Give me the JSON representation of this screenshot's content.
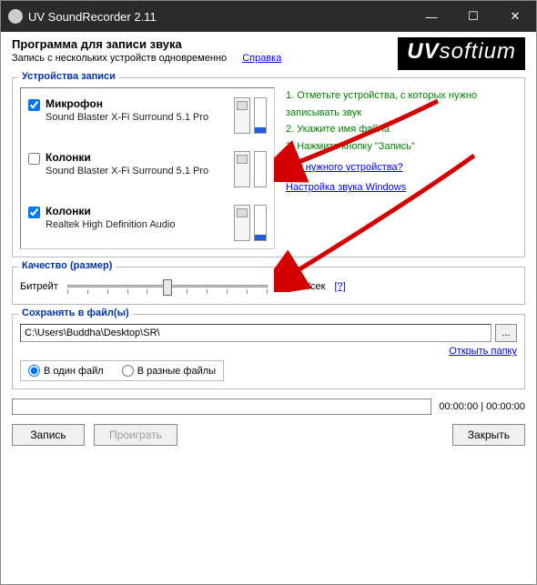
{
  "window": {
    "title": "UV SoundRecorder 2.11"
  },
  "header": {
    "title": "Программа для записи звука",
    "subtitle": "Запись с нескольких устройств одновременно",
    "help": "Справка",
    "brand_bold": "UV",
    "brand_rest": "softium"
  },
  "devices": {
    "group_title": "Устройства записи",
    "items": [
      {
        "checked": true,
        "name": "Микрофон",
        "desc": "Sound Blaster X-Fi Surround 5.1 Pro",
        "active": true
      },
      {
        "checked": false,
        "name": "Колонки",
        "desc": "Sound Blaster X-Fi Surround 5.1 Pro",
        "active": false
      },
      {
        "checked": true,
        "name": "Колонки",
        "desc": "Realtek High Definition Audio",
        "active": true
      }
    ],
    "hints": {
      "h1": "1. Отметьте устройства, с которых нужно записывать звук",
      "h2": "2. Укажите имя файла",
      "h3": "3. Нажмите кнопку \"Запись\"",
      "link1": "Нет нужного устройства?",
      "link2": "Настройка звука Windows"
    }
  },
  "quality": {
    "group_title": "Качество (размер)",
    "label": "Битрейт",
    "value": "128 Кб/сек",
    "help": "[?]"
  },
  "save": {
    "group_title": "Сохранять в файл(ы)",
    "path": "C:\\Users\\Buddha\\Desktop\\SR\\",
    "browse": "...",
    "open_folder": "Открыть папку",
    "radio_single": "В один файл",
    "radio_multi": "В разные файлы"
  },
  "progress": {
    "time": "00:00:00 | 00:00:00"
  },
  "buttons": {
    "record": "Запись",
    "play": "Проиграть",
    "close": "Закрыть"
  }
}
